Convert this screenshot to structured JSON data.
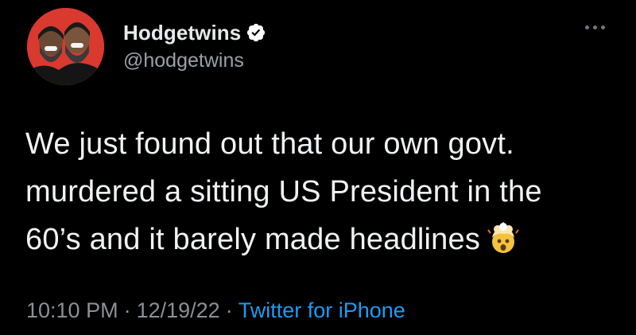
{
  "author": {
    "display_name": "Hodgetwins",
    "handle": "@hodgetwins",
    "verified": true,
    "avatar_icon": "avatar-two-bearded-men",
    "avatar_bg": "#d9392f"
  },
  "more_icon": "ellipsis-icon",
  "tweet": {
    "lines": [
      "We just found out that our own govt.",
      "murdered a sitting US President in the",
      "60’s and it barely made headlines"
    ],
    "emoji": "exploding-head-emoji"
  },
  "meta": {
    "time": "10:10 PM",
    "separator": "·",
    "date": "12/19/22",
    "source": "Twitter for iPhone"
  },
  "colors": {
    "background": "#000000",
    "text": "#e7e9ea",
    "secondary": "#8b9096",
    "link": "#1d9bf0",
    "verified_badge": "#ffffff"
  }
}
